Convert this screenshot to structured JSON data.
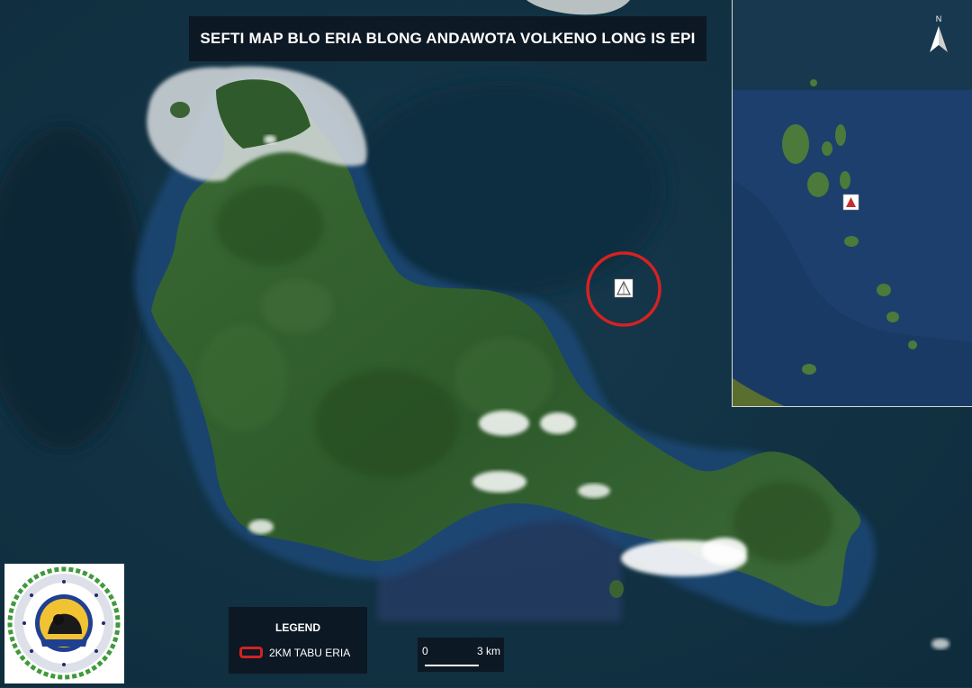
{
  "map": {
    "title": "SEFTI MAP BLO ERIA BLONG ANDAWOTA VOLKENO LONG IS EPI",
    "danger_color": "#d42222",
    "ocean_color": "#123548",
    "land_color": "#2f5a2c"
  },
  "legend": {
    "title": "LEGEND",
    "item_label": "2KM TABU ERIA"
  },
  "scale": {
    "start": "0",
    "end": "3 km"
  },
  "north_arrow": {
    "label": "N"
  },
  "logo": {
    "text": "Department Vanuatu Meterology and Geo-Hazards"
  },
  "icons": {
    "volcano_marker": "volcano-icon",
    "north": "north-arrow-icon"
  }
}
